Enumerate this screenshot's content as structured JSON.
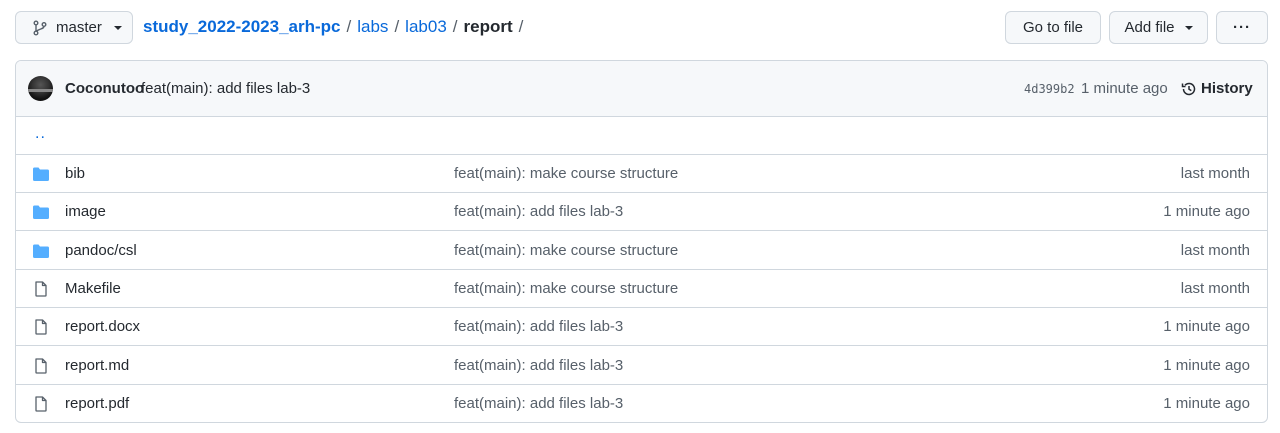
{
  "header": {
    "branch": "master",
    "repo": "study_2022-2023_arh-pc",
    "path": [
      "labs",
      "lab03"
    ],
    "current": "report",
    "trailing_sep": "/",
    "separator": "/",
    "buttons": {
      "go_to_file": "Go to file",
      "add_file": "Add file",
      "more": "···"
    }
  },
  "commit": {
    "author": "Coconutoo",
    "message": "feat(main): add files lab-3",
    "sha": "4d399b2",
    "time": "1 minute ago",
    "history_label": "History"
  },
  "parent_link": "..",
  "files": [
    {
      "type": "folder",
      "name": "bib",
      "message": "feat(main): make course structure",
      "age": "last month"
    },
    {
      "type": "folder",
      "name": "image",
      "message": "feat(main): add files lab-3",
      "age": "1 minute ago"
    },
    {
      "type": "folder",
      "name": "pandoc/csl",
      "message": "feat(main): make course structure",
      "age": "last month"
    },
    {
      "type": "file",
      "name": "Makefile",
      "message": "feat(main): make course structure",
      "age": "last month"
    },
    {
      "type": "file",
      "name": "report.docx",
      "message": "feat(main): add files lab-3",
      "age": "1 minute ago"
    },
    {
      "type": "file",
      "name": "report.md",
      "message": "feat(main): add files lab-3",
      "age": "1 minute ago"
    },
    {
      "type": "file",
      "name": "report.pdf",
      "message": "feat(main): add files lab-3",
      "age": "1 minute ago"
    }
  ],
  "colors": {
    "folder": "#54aeff",
    "link": "#0969da",
    "border": "#d0d7de"
  }
}
